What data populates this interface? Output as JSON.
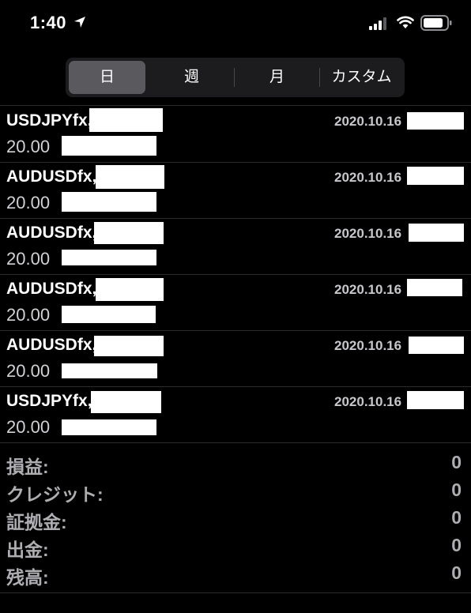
{
  "status_bar": {
    "time": "1:40"
  },
  "tabs": [
    {
      "label": "日",
      "selected": true
    },
    {
      "label": "週",
      "selected": false
    },
    {
      "label": "月",
      "selected": false
    },
    {
      "label": "カスタム",
      "selected": false
    }
  ],
  "trades": [
    {
      "symbol": "USDJPYfx,",
      "date": "2020.10.16",
      "volume": "20.00"
    },
    {
      "symbol": "AUDUSDfx,",
      "date": "2020.10.16",
      "volume": "20.00"
    },
    {
      "symbol": "AUDUSDfx,",
      "date": "2020.10.16",
      "volume": "20.00"
    },
    {
      "symbol": "AUDUSDfx,",
      "date": "2020.10.16",
      "volume": "20.00"
    },
    {
      "symbol": "AUDUSDfx,",
      "date": "2020.10.16",
      "volume": "20.00"
    },
    {
      "symbol": "USDJPYfx,",
      "date": "2020.10.16",
      "volume": "20.00"
    }
  ],
  "summary": [
    {
      "label": "損益:",
      "value": "0"
    },
    {
      "label": "クレジット:",
      "value": "0"
    },
    {
      "label": "証拠金:",
      "value": "0"
    },
    {
      "label": "出金:",
      "value": "0"
    },
    {
      "label": "残高:",
      "value": "0"
    }
  ],
  "colors": {
    "background": "#000000",
    "selected_tab": "#5a5a5e",
    "segmented_bg": "#1c1c1e"
  }
}
